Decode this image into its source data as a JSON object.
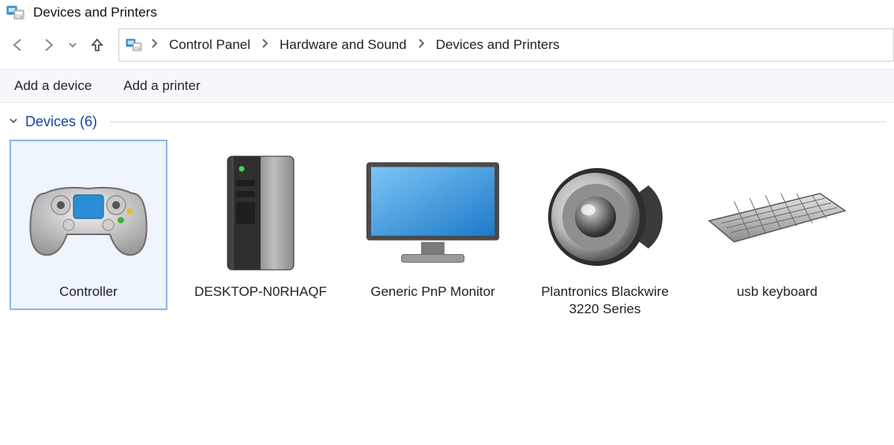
{
  "window": {
    "title": "Devices and Printers"
  },
  "breadcrumb": {
    "items": [
      {
        "label": "Control Panel"
      },
      {
        "label": "Hardware and Sound"
      },
      {
        "label": "Devices and Printers"
      }
    ]
  },
  "toolbar": {
    "add_device": "Add a device",
    "add_printer": "Add a printer"
  },
  "section": {
    "label": "Devices",
    "count_display": "(6)"
  },
  "devices": [
    {
      "name": "Controller",
      "icon": "gamepad",
      "selected": true
    },
    {
      "name": "DESKTOP-N0RHAQF",
      "icon": "desktop-tower",
      "selected": false
    },
    {
      "name": "Generic PnP Monitor",
      "icon": "monitor",
      "selected": false
    },
    {
      "name": "Plantronics Blackwire 3220 Series",
      "icon": "speaker",
      "selected": false
    },
    {
      "name": "usb keyboard",
      "icon": "keyboard",
      "selected": false
    }
  ]
}
